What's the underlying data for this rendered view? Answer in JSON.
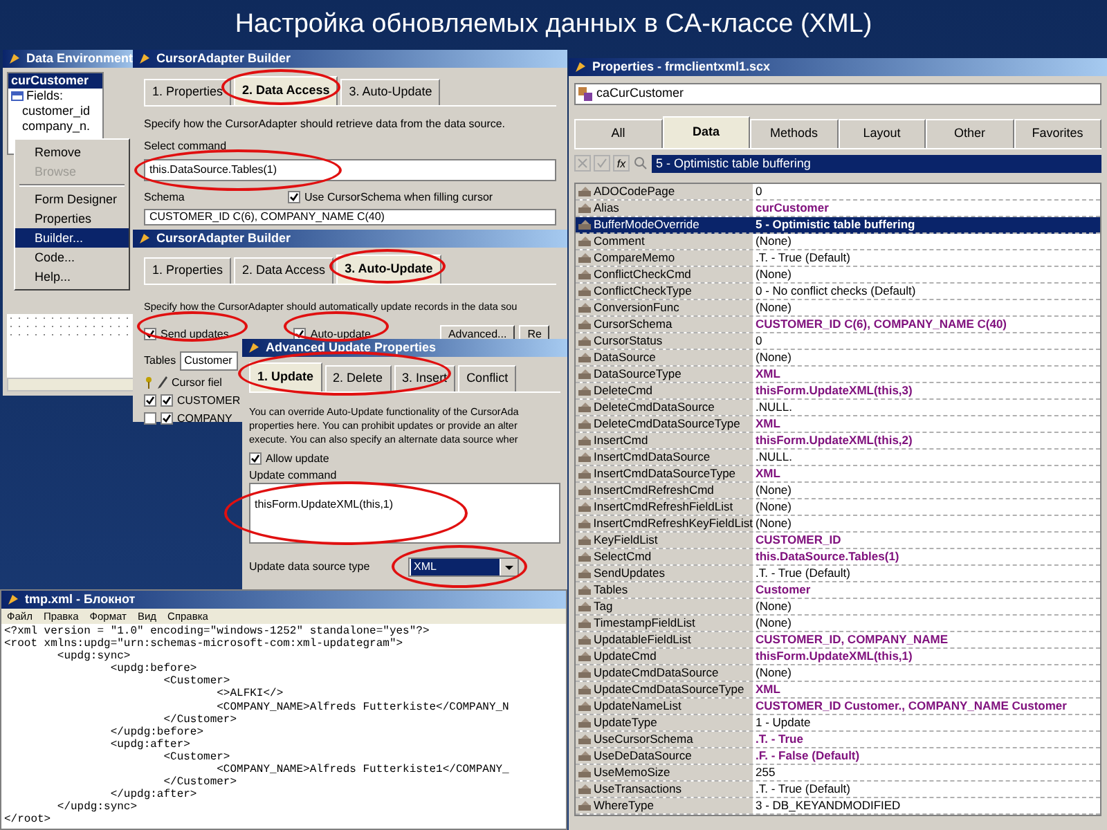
{
  "slide_title": "Настройка обновляемых данных в CA-классе (XML)",
  "data_environment": {
    "title": "Data Environment",
    "cursor": "curCustomer",
    "fields_label": "Fields:",
    "fields": [
      "customer_id",
      "company_n."
    ],
    "context_menu": [
      {
        "kind": "item",
        "label": "Remove",
        "disabled": false,
        "selected": false
      },
      {
        "kind": "item",
        "label": "Browse",
        "disabled": true,
        "selected": false
      },
      {
        "kind": "separator"
      },
      {
        "kind": "item",
        "label": "Form Designer",
        "disabled": false,
        "selected": false
      },
      {
        "kind": "item",
        "label": "Properties",
        "disabled": false,
        "selected": false
      },
      {
        "kind": "item",
        "label": "Builder...",
        "disabled": false,
        "selected": true
      },
      {
        "kind": "item",
        "label": "Code...",
        "disabled": false,
        "selected": false
      },
      {
        "kind": "item",
        "label": "Help...",
        "disabled": false,
        "selected": false
      }
    ]
  },
  "cursor_adapter_builder_1": {
    "title": "CursorAdapter Builder",
    "tabs": [
      {
        "label": "1. Properties",
        "selected": false
      },
      {
        "label": "2. Data Access",
        "selected": true
      },
      {
        "label": "3. Auto-Update",
        "selected": false
      }
    ],
    "description": "Specify how the CursorAdapter should retrieve data from the data source.",
    "select_command_label": "Select command",
    "select_command": "this.DataSource.Tables(1)",
    "schema_label": "Schema",
    "use_cursor_schema": {
      "label": "Use CursorSchema when filling cursor",
      "checked": true
    },
    "schema": "CUSTOMER_ID C(6), COMPANY_NAME C(40)"
  },
  "cursor_adapter_builder_2": {
    "title": "CursorAdapter Builder",
    "tabs": [
      {
        "label": "1. Properties",
        "selected": false
      },
      {
        "label": "2. Data Access",
        "selected": false
      },
      {
        "label": "3. Auto-Update",
        "selected": true
      }
    ],
    "description": "Specify how the CursorAdapter should automatically update records in the data sou",
    "send_updates": {
      "label": "Send updates",
      "checked": true
    },
    "auto_update": {
      "label": "Auto-update",
      "checked": true
    },
    "buttons": [
      "Advanced...",
      "Re"
    ],
    "tables_label": "Tables",
    "tables_value": "Customer",
    "fields_header": "Cursor fiel",
    "fields": [
      {
        "name": "CUSTOMER",
        "key": true,
        "updatable": true
      },
      {
        "name": "COMPANY",
        "key": false,
        "updatable": true
      }
    ]
  },
  "advanced_update_properties": {
    "title": "Advanced Update Properties",
    "tabs": [
      {
        "label": "1. Update",
        "selected": true
      },
      {
        "label": "2. Delete",
        "selected": false
      },
      {
        "label": "3. Insert",
        "selected": false
      },
      {
        "label": "Conflict",
        "selected": false
      }
    ],
    "description_lines": [
      "You can override Auto-Update functionality of the CursorAda",
      "properties here. You can prohibit updates or provide an alter",
      "execute. You can also specify an alternate data source wher"
    ],
    "allow_update": {
      "label": "Allow update",
      "checked": true
    },
    "update_command_label": "Update command",
    "update_command": "thisForm.UpdateXML(this,1)",
    "data_source_type_label": "Update data source type",
    "data_source_type": "XML"
  },
  "notepad": {
    "title": "tmp.xml - Блокнот",
    "menu": [
      "Файл",
      "Правка",
      "Формат",
      "Вид",
      "Справка"
    ],
    "lines": [
      "<?xml version = \"1.0\" encoding=\"windows-1252\" standalone=\"yes\"?>",
      "<root xmlns:updg=\"urn:schemas-microsoft-com:xml-updategram\">",
      "\t<updg:sync>",
      "\t\t<updg:before>",
      "\t\t\t<Customer>",
      "\t\t\t\t<>ALFKI</>",
      "\t\t\t\t<COMPANY_NAME>Alfreds Futterkiste</COMPANY_N",
      "\t\t\t</Customer>",
      "\t\t</updg:before>",
      "\t\t<updg:after>",
      "\t\t\t<Customer>",
      "\t\t\t\t<COMPANY_NAME>Alfreds Futterkiste1</COMPANY_",
      "\t\t\t</Customer>",
      "\t\t</updg:after>",
      "\t</updg:sync>",
      "</root>"
    ]
  },
  "properties_window": {
    "title": "Properties - frmclientxml1.scx",
    "object": "caCurCustomer",
    "tabs": [
      {
        "label": "All",
        "selected": false
      },
      {
        "label": "Data",
        "selected": true
      },
      {
        "label": "Methods",
        "selected": false
      },
      {
        "label": "Layout",
        "selected": false
      },
      {
        "label": "Other",
        "selected": false
      },
      {
        "label": "Favorites",
        "selected": false
      }
    ],
    "function_button": "fx",
    "edit_value": "5 - Optimistic table buffering",
    "rows": [
      {
        "name": "ADOCodePage",
        "value": "0",
        "modified": false,
        "selected": false
      },
      {
        "name": "Alias",
        "value": "curCustomer",
        "modified": true,
        "selected": false
      },
      {
        "name": "BufferModeOverride",
        "value": "5 - Optimistic table buffering",
        "modified": true,
        "selected": true
      },
      {
        "name": "Comment",
        "value": "(None)",
        "modified": false,
        "selected": false
      },
      {
        "name": "CompareMemo",
        "value": ".T. - True (Default)",
        "modified": false,
        "selected": false
      },
      {
        "name": "ConflictCheckCmd",
        "value": "(None)",
        "modified": false,
        "selected": false
      },
      {
        "name": "ConflictCheckType",
        "value": "0 - No conflict checks (Default)",
        "modified": false,
        "selected": false
      },
      {
        "name": "ConversionFunc",
        "value": "(None)",
        "modified": false,
        "selected": false
      },
      {
        "name": "CursorSchema",
        "value": "CUSTOMER_ID C(6), COMPANY_NAME C(40)",
        "modified": true,
        "selected": false
      },
      {
        "name": "CursorStatus",
        "value": "0",
        "modified": false,
        "selected": false
      },
      {
        "name": "DataSource",
        "value": "(None)",
        "modified": false,
        "selected": false
      },
      {
        "name": "DataSourceType",
        "value": "XML",
        "modified": true,
        "selected": false
      },
      {
        "name": "DeleteCmd",
        "value": "thisForm.UpdateXML(this,3)",
        "modified": true,
        "selected": false
      },
      {
        "name": "DeleteCmdDataSource",
        "value": ".NULL.",
        "modified": false,
        "selected": false
      },
      {
        "name": "DeleteCmdDataSourceType",
        "value": "XML",
        "modified": true,
        "selected": false
      },
      {
        "name": "InsertCmd",
        "value": "thisForm.UpdateXML(this,2)",
        "modified": true,
        "selected": false
      },
      {
        "name": "InsertCmdDataSource",
        "value": ".NULL.",
        "modified": false,
        "selected": false
      },
      {
        "name": "InsertCmdDataSourceType",
        "value": "XML",
        "modified": true,
        "selected": false
      },
      {
        "name": "InsertCmdRefreshCmd",
        "value": "(None)",
        "modified": false,
        "selected": false
      },
      {
        "name": "InsertCmdRefreshFieldList",
        "value": "(None)",
        "modified": false,
        "selected": false
      },
      {
        "name": "InsertCmdRefreshKeyFieldList",
        "value": "(None)",
        "modified": false,
        "selected": false
      },
      {
        "name": "KeyFieldList",
        "value": "CUSTOMER_ID",
        "modified": true,
        "selected": false
      },
      {
        "name": "SelectCmd",
        "value": "this.DataSource.Tables(1)",
        "modified": true,
        "selected": false
      },
      {
        "name": "SendUpdates",
        "value": ".T. - True (Default)",
        "modified": false,
        "selected": false
      },
      {
        "name": "Tables",
        "value": "Customer",
        "modified": true,
        "selected": false
      },
      {
        "name": "Tag",
        "value": "(None)",
        "modified": false,
        "selected": false
      },
      {
        "name": "TimestampFieldList",
        "value": "(None)",
        "modified": false,
        "selected": false
      },
      {
        "name": "UpdatableFieldList",
        "value": "CUSTOMER_ID, COMPANY_NAME",
        "modified": true,
        "selected": false
      },
      {
        "name": "UpdateCmd",
        "value": "thisForm.UpdateXML(this,1)",
        "modified": true,
        "selected": false
      },
      {
        "name": "UpdateCmdDataSource",
        "value": "(None)",
        "modified": false,
        "selected": false
      },
      {
        "name": "UpdateCmdDataSourceType",
        "value": "XML",
        "modified": true,
        "selected": false
      },
      {
        "name": "UpdateNameList",
        "value": "CUSTOMER_ID Customer., COMPANY_NAME Customer",
        "modified": true,
        "selected": false
      },
      {
        "name": "UpdateType",
        "value": "1 - Update",
        "modified": false,
        "selected": false
      },
      {
        "name": "UseCursorSchema",
        "value": ".T. - True",
        "modified": true,
        "selected": false
      },
      {
        "name": "UseDeDataSource",
        "value": ".F. - False (Default)",
        "modified": true,
        "selected": false
      },
      {
        "name": "UseMemoSize",
        "value": "255",
        "modified": false,
        "selected": false
      },
      {
        "name": "UseTransactions",
        "value": ".T. - True (Default)",
        "modified": false,
        "selected": false
      },
      {
        "name": "WhereType",
        "value": "3 - DB_KEYANDMODIFIED",
        "modified": false,
        "selected": false
      }
    ]
  }
}
